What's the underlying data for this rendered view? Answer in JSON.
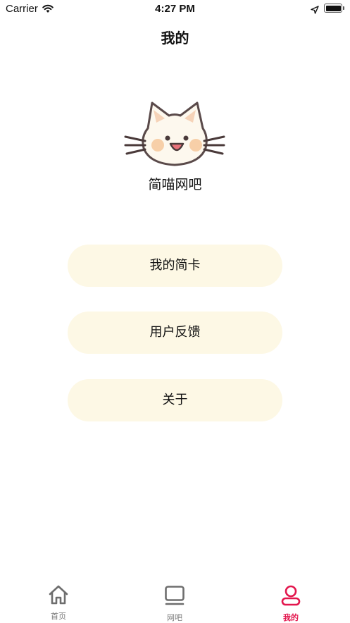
{
  "status_bar": {
    "carrier": "Carrier",
    "time": "4:27 PM"
  },
  "nav": {
    "title": "我的"
  },
  "profile": {
    "name": "简喵网吧",
    "avatar": "cat-face-icon"
  },
  "menu": [
    {
      "label": "我的简卡"
    },
    {
      "label": "用户反馈"
    },
    {
      "label": "关于"
    }
  ],
  "tabs": [
    {
      "label": "首页",
      "icon": "home-icon",
      "active": false
    },
    {
      "label": "网吧",
      "icon": "monitor-icon",
      "active": false
    },
    {
      "label": "我的",
      "icon": "user-icon",
      "active": true
    }
  ],
  "colors": {
    "accent": "#e3164d",
    "button_bg": "#fdf8e5",
    "tab_inactive": "#7a7a7a"
  }
}
